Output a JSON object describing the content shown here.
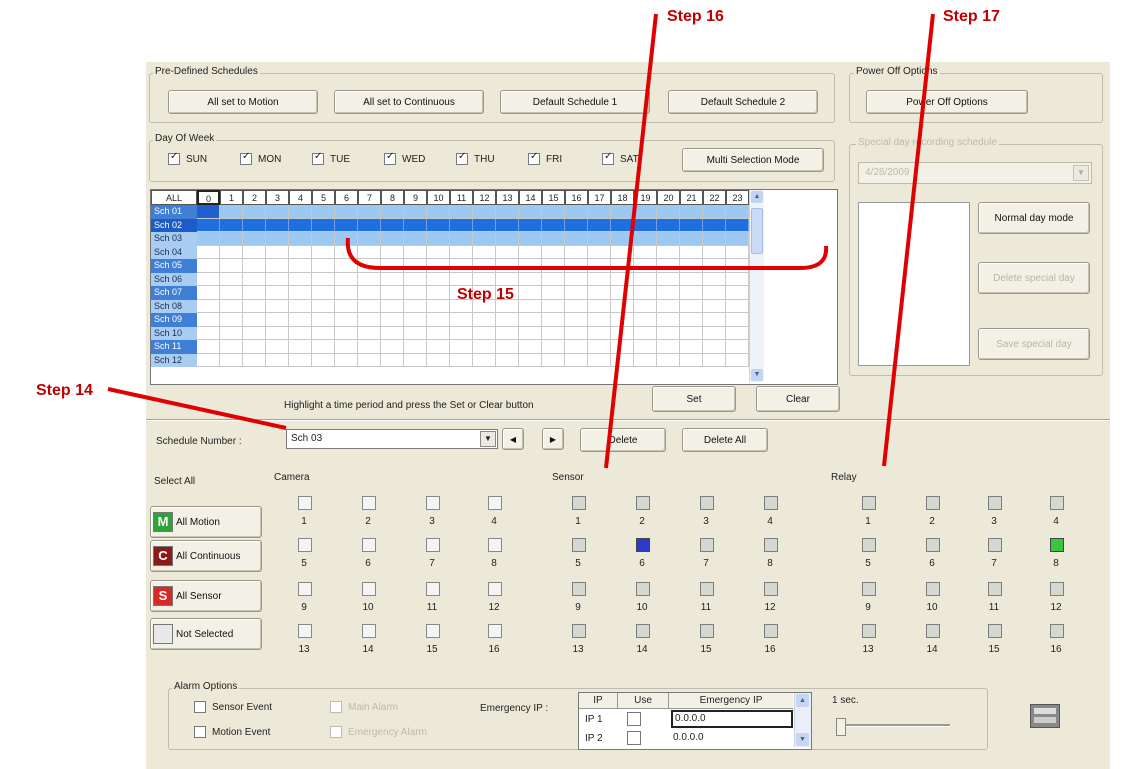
{
  "predefined": {
    "title": "Pre-Defined Schedules",
    "buttons": [
      "All set to Motion",
      "All set to Continuous",
      "Default Schedule 1",
      "Default Schedule 2"
    ]
  },
  "power": {
    "title": "Power Off Options",
    "button": "Power Off Options"
  },
  "dayofweek": {
    "title": "Day Of Week",
    "days": [
      "SUN",
      "MON",
      "TUE",
      "WED",
      "THU",
      "FRI",
      "SAT"
    ],
    "multi_mode": "Multi Selection Mode"
  },
  "special": {
    "title": "Special day recording schedule",
    "date": "4/28/2009",
    "normal_btn": "Normal day mode",
    "delete_btn": "Delete special day",
    "save_btn": "Save special day"
  },
  "grid": {
    "all_label": "ALL",
    "hours": [
      "0",
      "1",
      "2",
      "3",
      "4",
      "5",
      "6",
      "7",
      "8",
      "9",
      "10",
      "11",
      "12",
      "13",
      "14",
      "15",
      "16",
      "17",
      "18",
      "19",
      "20",
      "21",
      "22",
      "23"
    ],
    "rows": [
      "Sch 01",
      "Sch 02",
      "Sch 03",
      "Sch 04",
      "Sch 05",
      "Sch 06",
      "Sch 07",
      "Sch 08",
      "Sch 09",
      "Sch 10",
      "Sch 11",
      "Sch 12"
    ],
    "hint": "Highlight a time period and press the Set or Clear button",
    "set": "Set",
    "clear": "Clear"
  },
  "schedule": {
    "label": "Schedule Number :",
    "value": "Sch 03",
    "delete": "Delete",
    "delete_all": "Delete All"
  },
  "select_all": {
    "label": "Select All",
    "items": [
      {
        "letter": "M",
        "text": "All Motion",
        "color": "#2fa33a"
      },
      {
        "letter": "C",
        "text": "All Continuous",
        "color": "#8b1a1a"
      },
      {
        "letter": "S",
        "text": "All Sensor",
        "color": "#d42a2a"
      },
      {
        "letter": "",
        "text": "Not Selected",
        "color": "#e8e8e8"
      }
    ]
  },
  "camera": {
    "title": "Camera",
    "numbers": [
      "1",
      "2",
      "3",
      "4",
      "5",
      "6",
      "7",
      "8",
      "9",
      "10",
      "11",
      "12",
      "13",
      "14",
      "15",
      "16"
    ]
  },
  "sensor": {
    "title": "Sensor",
    "numbers": [
      "1",
      "2",
      "3",
      "4",
      "5",
      "6",
      "7",
      "8",
      "9",
      "10",
      "11",
      "12",
      "13",
      "14",
      "15",
      "16"
    ],
    "active": 6,
    "active_color": "#2b3bcc"
  },
  "relay": {
    "title": "Relay",
    "numbers": [
      "1",
      "2",
      "3",
      "4",
      "5",
      "6",
      "7",
      "8",
      "9",
      "10",
      "11",
      "12",
      "13",
      "14",
      "15",
      "16"
    ],
    "active": 8,
    "active_color": "#3cc63c"
  },
  "alarm": {
    "title": "Alarm Options",
    "sensor_event": "Sensor Event",
    "motion_event": "Motion Event",
    "main_alarm": "Main Alarm",
    "emergency_alarm": "Emergency Alarm",
    "emergency_ip_label": "Emergency IP :",
    "table_headers": [
      "IP",
      "Use",
      "Emergency IP"
    ],
    "rows": [
      {
        "ip": "IP 1",
        "value": "0.0.0.0"
      },
      {
        "ip": "IP 2",
        "value": "0.0.0.0"
      }
    ],
    "slider_label": "1 sec."
  },
  "steps": [
    "Step 14",
    "Step 15",
    "Step 16",
    "Step 17"
  ],
  "colors": {
    "selected_row": "#2f74d8",
    "row_header": "#4f86d6",
    "highlight": "#aad0f4",
    "annotation": "#e00000"
  }
}
